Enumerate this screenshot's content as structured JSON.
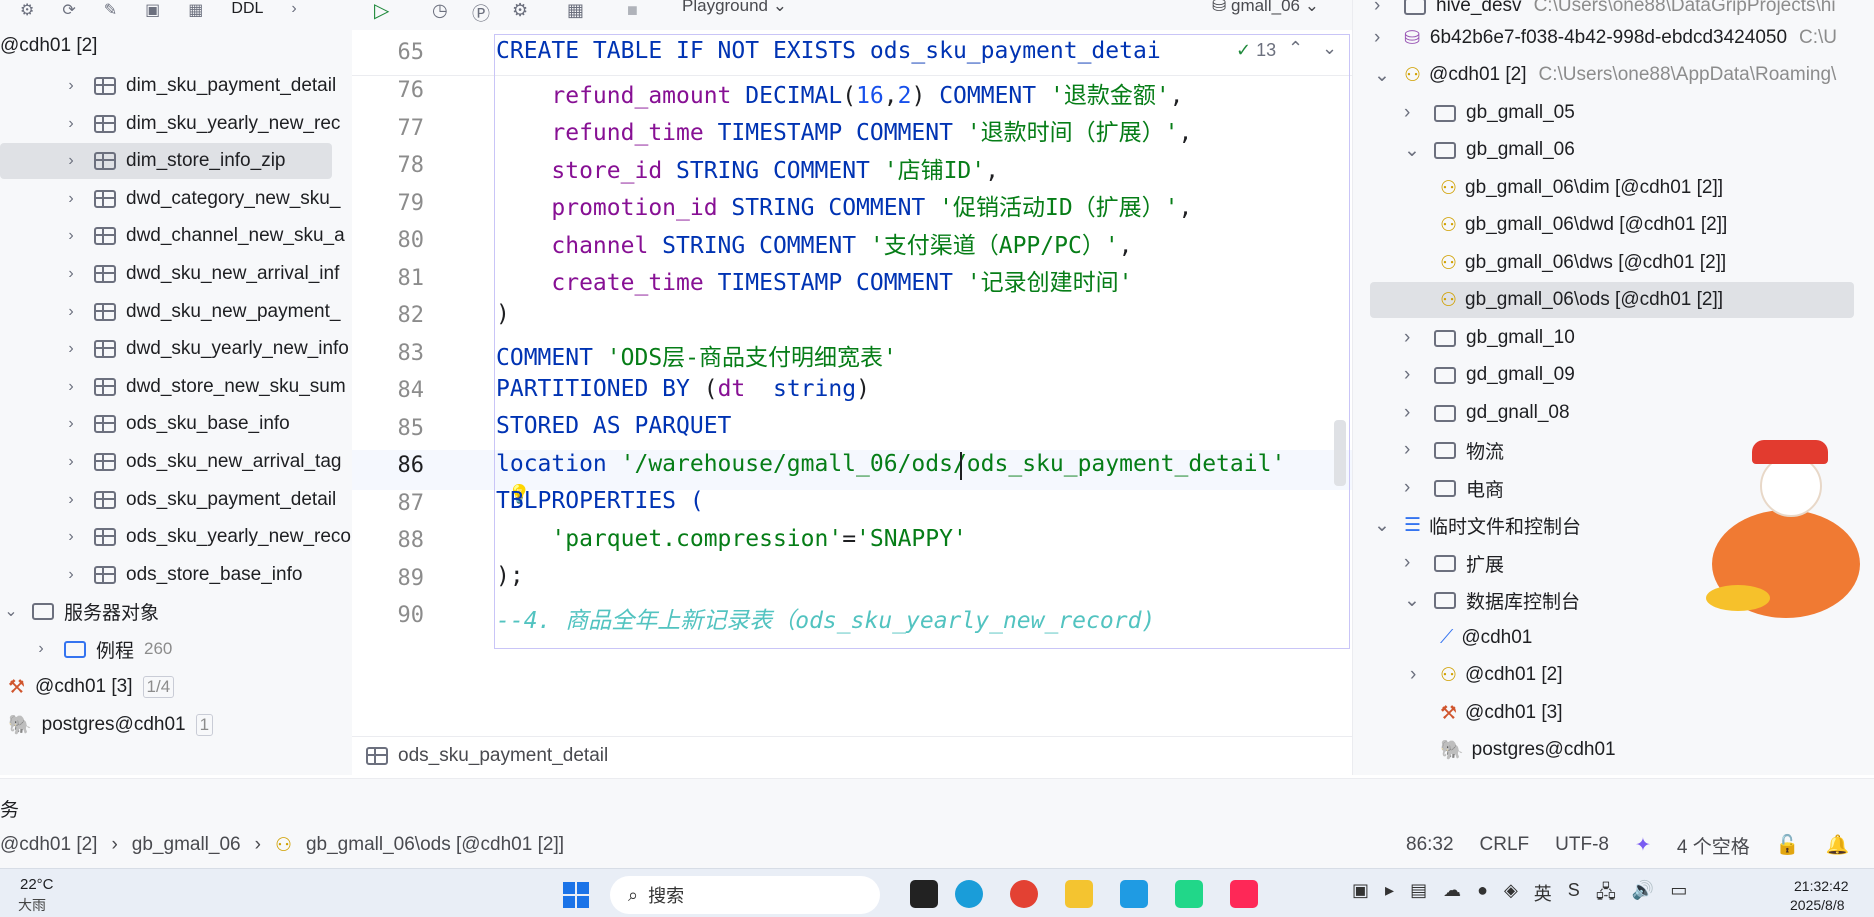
{
  "left_toolbar": {
    "ddl_label": "DDL"
  },
  "left_root": "@cdh01 [2]",
  "left_tables": [
    "dim_sku_payment_detail",
    "dim_sku_yearly_new_rec",
    "dim_store_info_zip",
    "dwd_category_new_sku_",
    "dwd_channel_new_sku_a",
    "dwd_sku_new_arrival_inf",
    "dwd_sku_new_payment_",
    "dwd_sku_yearly_new_info",
    "dwd_store_new_sku_sum",
    "ods_sku_base_info",
    "ods_sku_new_arrival_tag",
    "ods_sku_payment_detail",
    "ods_sku_yearly_new_reco",
    "ods_store_base_info"
  ],
  "left_server_objects": "服务器对象",
  "left_routines": {
    "label": "例程",
    "count": "260"
  },
  "left_cdh3": {
    "label": "@cdh01 [3]",
    "badge": "1/4"
  },
  "left_pg": {
    "label": "postgres@cdh01",
    "badge": "1"
  },
  "editor_toolbar": {
    "playground": "Playground",
    "schema": "gmall_06"
  },
  "sticky": {
    "line": "65",
    "text": "CREATE TABLE IF NOT EXISTS ods_sku_payment_detai",
    "checks": "13"
  },
  "lines": [
    "76",
    "77",
    "78",
    "79",
    "80",
    "81",
    "82",
    "83",
    "84",
    "85",
    "86",
    "87",
    "88",
    "89",
    "90"
  ],
  "code": {
    "l76": [
      "refund_amount ",
      "DECIMAL",
      "(",
      "16",
      ",",
      "2",
      ") ",
      "COMMENT ",
      "'退款金额'",
      ","
    ],
    "l77": [
      "refund_time ",
      "TIMESTAMP ",
      "COMMENT ",
      "'退款时间（扩展）'",
      ","
    ],
    "l78": [
      "store_id ",
      "STRING ",
      "COMMENT ",
      "'店铺ID'",
      ","
    ],
    "l79": [
      "promotion_id ",
      "STRING ",
      "COMMENT ",
      "'促销活动ID（扩展）'",
      ","
    ],
    "l80": [
      "channel ",
      "STRING ",
      "COMMENT ",
      "'支付渠道（APP/PC）'",
      ","
    ],
    "l81": [
      "create_time ",
      "TIMESTAMP ",
      "COMMENT ",
      "'记录创建时间'"
    ],
    "l82": ")",
    "l83": [
      "COMMENT ",
      "'ODS层-商品支付明细宽表'"
    ],
    "l84": [
      "PARTITIONED BY ",
      "(",
      "dt  ",
      "string",
      ")"
    ],
    "l85": "STORED AS PARQUET",
    "l86": [
      "location ",
      "'/warehouse/gmall_06/ods/ods_sku_payment_detail'"
    ],
    "l87": "TBLPROPERTIES (",
    "l88": [
      "'parquet.compression'",
      "=",
      "'SNAPPY'"
    ],
    "l89": ");",
    "l90": "--4. 商品全年上新记录表（ods_sku_yearly_new_record)"
  },
  "editor_crumb": "ods_sku_payment_detail",
  "right_tree": {
    "hive": {
      "label": "hive_desv",
      "path": "C:\\Users\\one88\\DataGripProjects\\hi"
    },
    "uuid": {
      "label": "6b42b6e7-f038-4b42-998d-ebdcd3424050",
      "path": "C:\\U"
    },
    "cdh2": {
      "label": "@cdh01 [2]",
      "path": "C:\\Users\\one88\\AppData\\Roaming\\"
    },
    "gb05": "gb_gmall_05",
    "gb06": "gb_gmall_06",
    "gb06_children": [
      "gb_gmall_06\\dim [@cdh01 [2]]",
      "gb_gmall_06\\dwd [@cdh01 [2]]",
      "gb_gmall_06\\dws [@cdh01 [2]]",
      "gb_gmall_06\\ods [@cdh01 [2]]"
    ],
    "gb10": "gb_gmall_10",
    "gd09": "gd_gmall_09",
    "gd08": "gd_gnall_08",
    "wuliu": "物流",
    "dianshang": "电商",
    "scratch": "临时文件和控制台",
    "ext": "扩展",
    "consoles": "数据库控制台",
    "console_items": [
      "@cdh01",
      "@cdh01 [2]",
      "@cdh01 [3]",
      "postgres@cdh01"
    ]
  },
  "status_left_char": "务",
  "status_crumbs": [
    "@cdh01 [2]",
    "gb_gmall_06",
    "gb_gmall_06\\ods [@cdh01 [2]]"
  ],
  "status_right": {
    "pos": "86:32",
    "eol": "CRLF",
    "enc": "UTF-8",
    "indent": "4 个空格"
  },
  "weather": {
    "temp": "22°C",
    "desc": "大雨"
  },
  "search_label": "搜索",
  "clock": {
    "time": "21:32:42",
    "date": "2025/8/8"
  }
}
